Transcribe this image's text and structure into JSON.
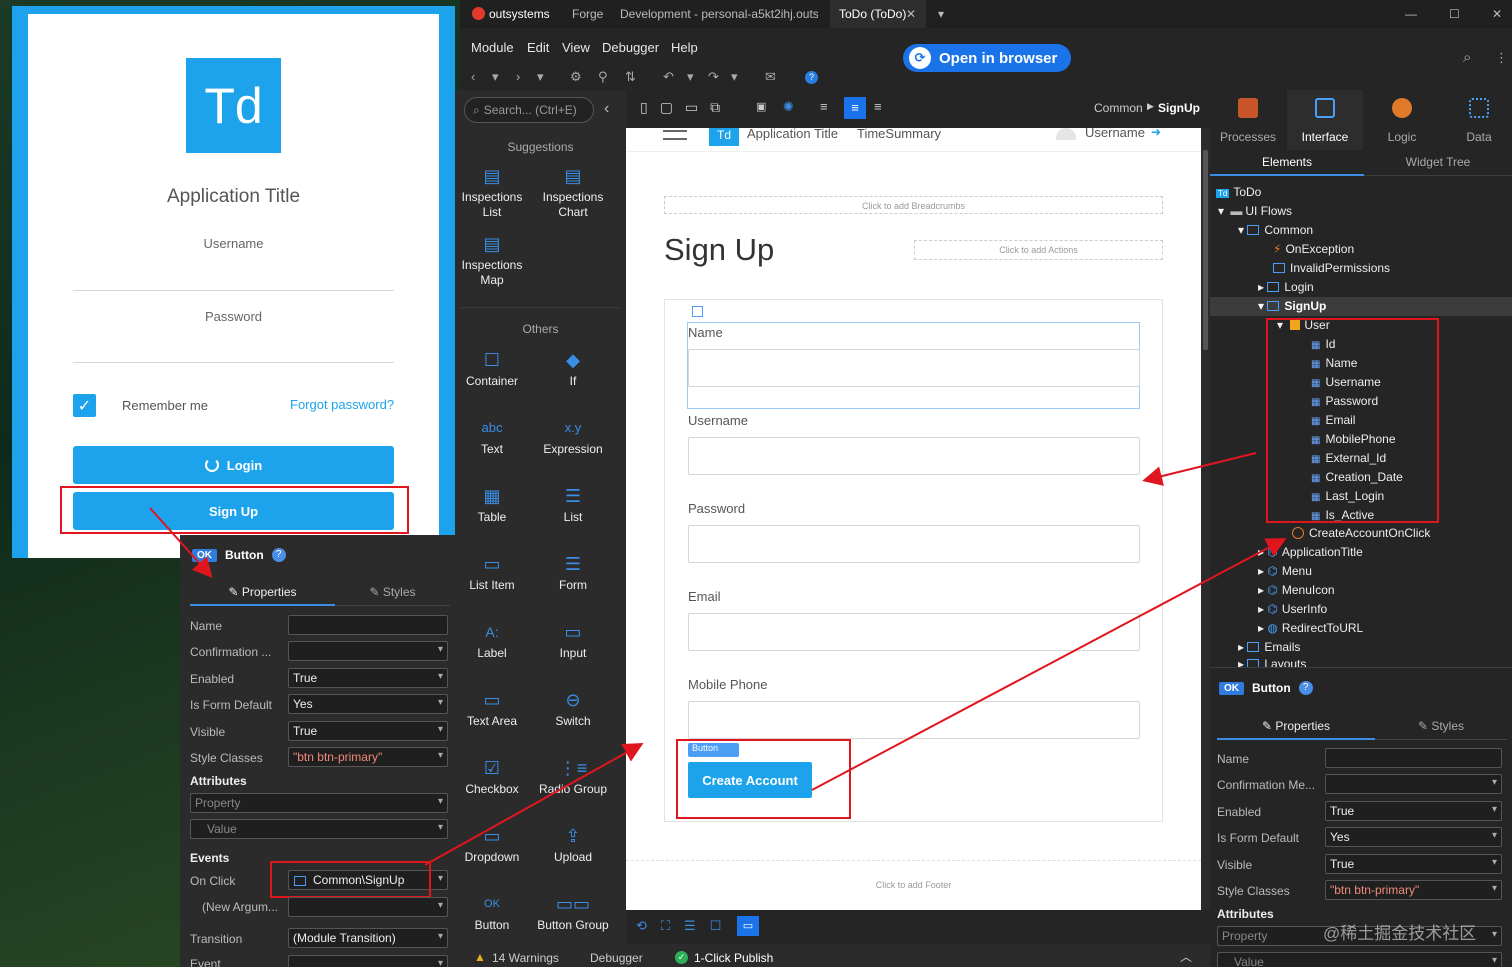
{
  "preview": {
    "logo_text": "Td",
    "app_title": "Application Title",
    "username_label": "Username",
    "password_label": "Password",
    "remember_label": "Remember me",
    "forgot_label": "Forgot password?",
    "login_label": "Login",
    "signup_label": "Sign Up"
  },
  "topbar": {
    "brand": "outsystems",
    "forge": "Forge",
    "env": "Development - personal-a5kt2ihj.outs",
    "tab": "ToDo (ToDo)"
  },
  "menu": [
    "Module",
    "Edit",
    "View",
    "Debugger",
    "Help"
  ],
  "open_browser": "Open in browser",
  "toolbox": {
    "search_placeholder": "Search... (Ctrl+E)",
    "suggestions_title": "Suggestions",
    "suggestions": [
      "Inspections List",
      "Inspections Chart",
      "Inspections Map"
    ],
    "others_title": "Others",
    "tools": [
      "Container",
      "If",
      "Text",
      "Expression",
      "Table",
      "List",
      "List Item",
      "Form",
      "Label",
      "Input",
      "Text Area",
      "Switch",
      "Checkbox",
      "Radio Group",
      "Dropdown",
      "Upload",
      "Button",
      "Button Group"
    ],
    "tool_icons": [
      "abc",
      "x.y",
      "A:"
    ]
  },
  "canvas": {
    "breadcrumb_parent": "Common",
    "breadcrumb_current": "SignUp",
    "header_logo": "Td",
    "header_app_title": "Application Title",
    "header_link": "TimeSummary",
    "header_user": "Username",
    "breadcrumbs_placeholder": "Click to add Breadcrumbs",
    "actions_placeholder": "Click to add Actions",
    "title": "Sign Up",
    "fields": [
      "Name",
      "Username",
      "Password",
      "Email",
      "Mobile Phone"
    ],
    "button_tag": "Button",
    "create_label": "Create Account",
    "footer_placeholder": "Click to add Footer"
  },
  "statusbar": {
    "warnings": "14 Warnings",
    "debugger": "Debugger",
    "publish": "1-Click Publish"
  },
  "right_panel": {
    "tabs": [
      "Processes",
      "Interface",
      "Logic",
      "Data"
    ],
    "subtabs": [
      "Elements",
      "Widget Tree"
    ],
    "tree": {
      "root": "ToDo",
      "ui_flows": "UI Flows",
      "common": "Common",
      "on_exception": "OnException",
      "invalid_permissions": "InvalidPermissions",
      "login": "Login",
      "signup": "SignUp",
      "user": "User",
      "user_attrs": [
        "Id",
        "Name",
        "Username",
        "Password",
        "Email",
        "MobilePhone",
        "External_Id",
        "Creation_Date",
        "Last_Login",
        "Is_Active"
      ],
      "create_action": "CreateAccountOnClick",
      "blocks": [
        "ApplicationTitle",
        "Menu",
        "MenuIcon",
        "UserInfo",
        "RedirectToURL"
      ],
      "emails": "Emails",
      "layouts": "Layouts"
    }
  },
  "props": {
    "badge": "OK",
    "widget": "Button",
    "properties_tab": "Properties",
    "styles_tab": "Styles",
    "rows": [
      {
        "label": "Name",
        "value": ""
      },
      {
        "label": "Confirmation ...",
        "value": ""
      },
      {
        "label": "Enabled",
        "value": "True"
      },
      {
        "label": "Is Form Default",
        "value": "Yes"
      },
      {
        "label": "Visible",
        "value": "True"
      },
      {
        "label": "Style Classes",
        "value": "\"btn btn-primary\""
      }
    ],
    "right_rows_label_confirm": "Confirmation Me...",
    "attributes_title": "Attributes",
    "attr_property": "Property",
    "attr_value": "Value",
    "events_title": "Events",
    "on_click_label": "On Click",
    "on_click_value": "Common\\SignUp",
    "new_arg_label": "(New Argum...",
    "transition_label": "Transition",
    "transition_value": "(Module Transition)",
    "event_label": "Event"
  },
  "watermark": "@稀土掘金技术社区",
  "colors": {
    "accent": "#1ca3ec",
    "annotation": "#e0161f",
    "ide_bg": "#252526"
  }
}
